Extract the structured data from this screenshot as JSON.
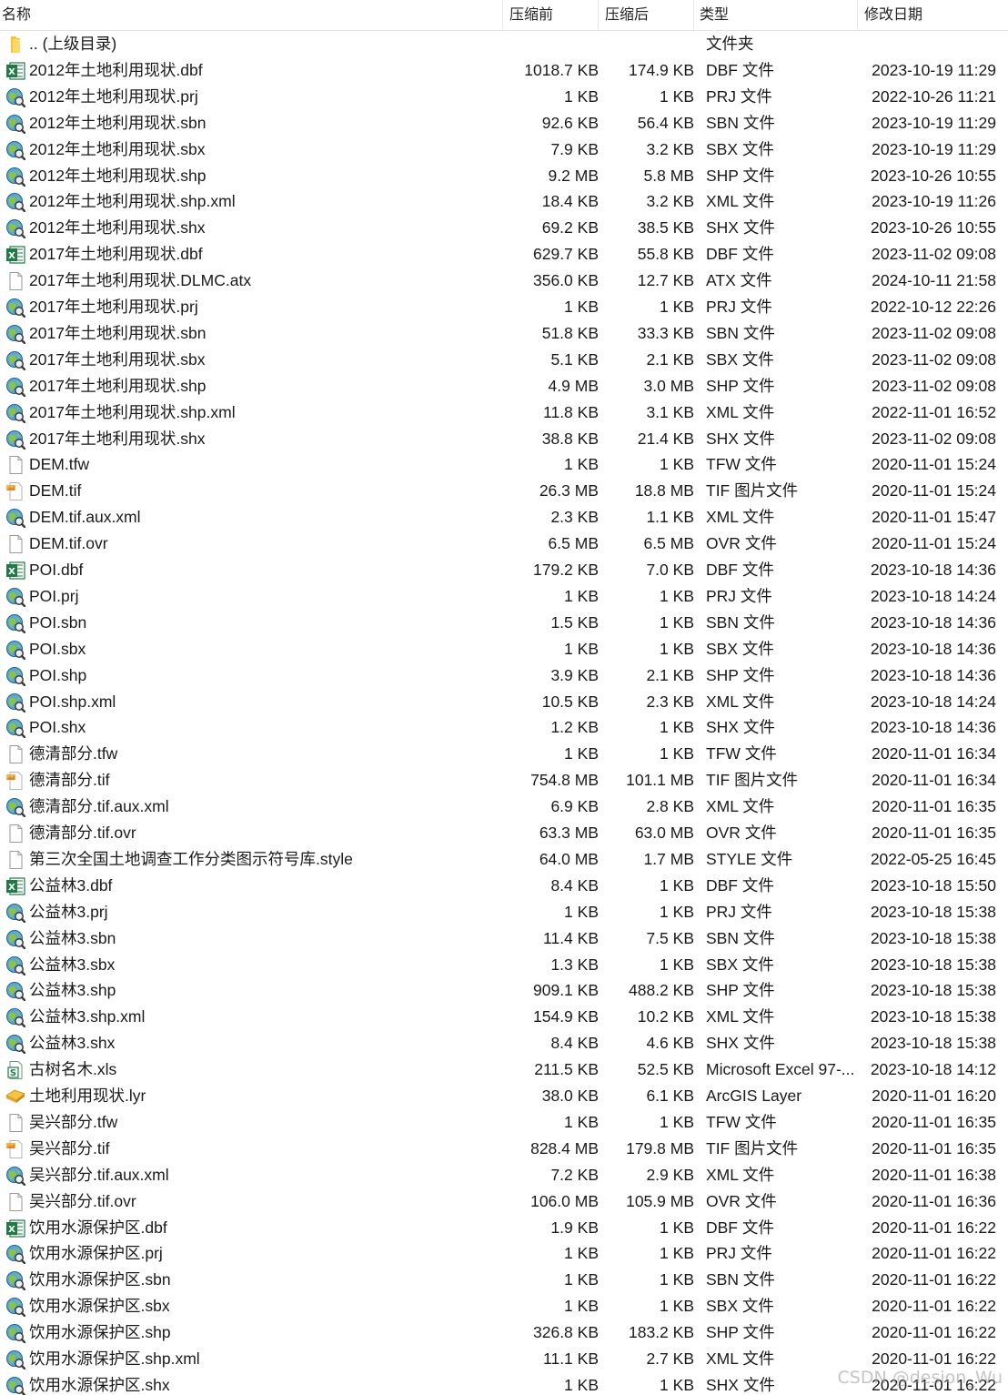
{
  "columns": {
    "name": "名称",
    "size": "压缩前",
    "compressed": "压缩后",
    "type": "类型",
    "modified": "修改日期"
  },
  "files": [
    {
      "icon": "folder-icon",
      "name": ".. (上级目录)",
      "size": "",
      "compressed": "",
      "type": "文件夹",
      "modified": ""
    },
    {
      "icon": "excel-icon",
      "name": "2012年土地利用现状.dbf",
      "size": "1018.7 KB",
      "compressed": "174.9 KB",
      "type": "DBF 文件",
      "modified": "2023-10-19 11:29"
    },
    {
      "icon": "globe-icon",
      "name": "2012年土地利用现状.prj",
      "size": "1 KB",
      "compressed": "1 KB",
      "type": "PRJ 文件",
      "modified": "2022-10-26 11:21"
    },
    {
      "icon": "globe-icon",
      "name": "2012年土地利用现状.sbn",
      "size": "92.6 KB",
      "compressed": "56.4 KB",
      "type": "SBN 文件",
      "modified": "2023-10-19 11:29"
    },
    {
      "icon": "globe-icon",
      "name": "2012年土地利用现状.sbx",
      "size": "7.9 KB",
      "compressed": "3.2 KB",
      "type": "SBX 文件",
      "modified": "2023-10-19 11:29"
    },
    {
      "icon": "globe-icon",
      "name": "2012年土地利用现状.shp",
      "size": "9.2 MB",
      "compressed": "5.8 MB",
      "type": "SHP 文件",
      "modified": "2023-10-26 10:55"
    },
    {
      "icon": "globe-icon",
      "name": "2012年土地利用现状.shp.xml",
      "size": "18.4 KB",
      "compressed": "3.2 KB",
      "type": "XML 文件",
      "modified": "2023-10-19 11:26"
    },
    {
      "icon": "globe-icon",
      "name": "2012年土地利用现状.shx",
      "size": "69.2 KB",
      "compressed": "38.5 KB",
      "type": "SHX 文件",
      "modified": "2023-10-26 10:55"
    },
    {
      "icon": "excel-icon",
      "name": "2017年土地利用现状.dbf",
      "size": "629.7 KB",
      "compressed": "55.8 KB",
      "type": "DBF 文件",
      "modified": "2023-11-02 09:08"
    },
    {
      "icon": "blank-file-icon",
      "name": "2017年土地利用现状.DLMC.atx",
      "size": "356.0 KB",
      "compressed": "12.7 KB",
      "type": "ATX 文件",
      "modified": "2024-10-11 21:58"
    },
    {
      "icon": "globe-icon",
      "name": "2017年土地利用现状.prj",
      "size": "1 KB",
      "compressed": "1 KB",
      "type": "PRJ 文件",
      "modified": "2022-10-12 22:26"
    },
    {
      "icon": "globe-icon",
      "name": "2017年土地利用现状.sbn",
      "size": "51.8 KB",
      "compressed": "33.3 KB",
      "type": "SBN 文件",
      "modified": "2023-11-02 09:08"
    },
    {
      "icon": "globe-icon",
      "name": "2017年土地利用现状.sbx",
      "size": "5.1 KB",
      "compressed": "2.1 KB",
      "type": "SBX 文件",
      "modified": "2023-11-02 09:08"
    },
    {
      "icon": "globe-icon",
      "name": "2017年土地利用现状.shp",
      "size": "4.9 MB",
      "compressed": "3.0 MB",
      "type": "SHP 文件",
      "modified": "2023-11-02 09:08"
    },
    {
      "icon": "globe-icon",
      "name": "2017年土地利用现状.shp.xml",
      "size": "11.8 KB",
      "compressed": "3.1 KB",
      "type": "XML 文件",
      "modified": "2022-11-01 16:52"
    },
    {
      "icon": "globe-icon",
      "name": "2017年土地利用现状.shx",
      "size": "38.8 KB",
      "compressed": "21.4 KB",
      "type": "SHX 文件",
      "modified": "2023-11-02 09:08"
    },
    {
      "icon": "blank-file-icon",
      "name": "DEM.tfw",
      "size": "1 KB",
      "compressed": "1 KB",
      "type": "TFW 文件",
      "modified": "2020-11-01 15:24"
    },
    {
      "icon": "image-file-icon",
      "name": "DEM.tif",
      "size": "26.3 MB",
      "compressed": "18.8 MB",
      "type": "TIF 图片文件",
      "modified": "2020-11-01 15:24"
    },
    {
      "icon": "globe-icon",
      "name": "DEM.tif.aux.xml",
      "size": "2.3 KB",
      "compressed": "1.1 KB",
      "type": "XML 文件",
      "modified": "2020-11-01 15:47"
    },
    {
      "icon": "blank-file-icon",
      "name": "DEM.tif.ovr",
      "size": "6.5 MB",
      "compressed": "6.5 MB",
      "type": "OVR 文件",
      "modified": "2020-11-01 15:24"
    },
    {
      "icon": "excel-icon",
      "name": "POI.dbf",
      "size": "179.2 KB",
      "compressed": "7.0 KB",
      "type": "DBF 文件",
      "modified": "2023-10-18 14:36"
    },
    {
      "icon": "globe-icon",
      "name": "POI.prj",
      "size": "1 KB",
      "compressed": "1 KB",
      "type": "PRJ 文件",
      "modified": "2023-10-18 14:24"
    },
    {
      "icon": "globe-icon",
      "name": "POI.sbn",
      "size": "1.5 KB",
      "compressed": "1 KB",
      "type": "SBN 文件",
      "modified": "2023-10-18 14:36"
    },
    {
      "icon": "globe-icon",
      "name": "POI.sbx",
      "size": "1 KB",
      "compressed": "1 KB",
      "type": "SBX 文件",
      "modified": "2023-10-18 14:36"
    },
    {
      "icon": "globe-icon",
      "name": "POI.shp",
      "size": "3.9 KB",
      "compressed": "2.1 KB",
      "type": "SHP 文件",
      "modified": "2023-10-18 14:36"
    },
    {
      "icon": "globe-icon",
      "name": "POI.shp.xml",
      "size": "10.5 KB",
      "compressed": "2.3 KB",
      "type": "XML 文件",
      "modified": "2023-10-18 14:24"
    },
    {
      "icon": "globe-icon",
      "name": "POI.shx",
      "size": "1.2 KB",
      "compressed": "1 KB",
      "type": "SHX 文件",
      "modified": "2023-10-18 14:36"
    },
    {
      "icon": "blank-file-icon",
      "name": "德清部分.tfw",
      "size": "1 KB",
      "compressed": "1 KB",
      "type": "TFW 文件",
      "modified": "2020-11-01 16:34"
    },
    {
      "icon": "image-file-icon",
      "name": "德清部分.tif",
      "size": "754.8 MB",
      "compressed": "101.1 MB",
      "type": "TIF 图片文件",
      "modified": "2020-11-01 16:34"
    },
    {
      "icon": "globe-icon",
      "name": "德清部分.tif.aux.xml",
      "size": "6.9 KB",
      "compressed": "2.8 KB",
      "type": "XML 文件",
      "modified": "2020-11-01 16:35"
    },
    {
      "icon": "blank-file-icon",
      "name": "德清部分.tif.ovr",
      "size": "63.3 MB",
      "compressed": "63.0 MB",
      "type": "OVR 文件",
      "modified": "2020-11-01 16:35"
    },
    {
      "icon": "blank-file-icon",
      "name": "第三次全国土地调查工作分类图示符号库.style",
      "size": "64.0 MB",
      "compressed": "1.7 MB",
      "type": "STYLE 文件",
      "modified": "2022-05-25 16:45"
    },
    {
      "icon": "excel-icon",
      "name": "公益林3.dbf",
      "size": "8.4 KB",
      "compressed": "1 KB",
      "type": "DBF 文件",
      "modified": "2023-10-18 15:50"
    },
    {
      "icon": "globe-icon",
      "name": "公益林3.prj",
      "size": "1 KB",
      "compressed": "1 KB",
      "type": "PRJ 文件",
      "modified": "2023-10-18 15:38"
    },
    {
      "icon": "globe-icon",
      "name": "公益林3.sbn",
      "size": "11.4 KB",
      "compressed": "7.5 KB",
      "type": "SBN 文件",
      "modified": "2023-10-18 15:38"
    },
    {
      "icon": "globe-icon",
      "name": "公益林3.sbx",
      "size": "1.3 KB",
      "compressed": "1 KB",
      "type": "SBX 文件",
      "modified": "2023-10-18 15:38"
    },
    {
      "icon": "globe-icon",
      "name": "公益林3.shp",
      "size": "909.1 KB",
      "compressed": "488.2 KB",
      "type": "SHP 文件",
      "modified": "2023-10-18 15:38"
    },
    {
      "icon": "globe-icon",
      "name": "公益林3.shp.xml",
      "size": "154.9 KB",
      "compressed": "10.2 KB",
      "type": "XML 文件",
      "modified": "2023-10-18 15:38"
    },
    {
      "icon": "globe-icon",
      "name": "公益林3.shx",
      "size": "8.4 KB",
      "compressed": "4.6 KB",
      "type": "SHX 文件",
      "modified": "2023-10-18 15:38"
    },
    {
      "icon": "spreadsheet-icon",
      "name": "古树名木.xls",
      "size": "211.5 KB",
      "compressed": "52.5 KB",
      "type": "Microsoft Excel 97-...",
      "modified": "2023-10-18 14:12"
    },
    {
      "icon": "layer-icon",
      "name": "土地利用现状.lyr",
      "size": "38.0 KB",
      "compressed": "6.1 KB",
      "type": "ArcGIS Layer",
      "modified": "2020-11-01 16:20"
    },
    {
      "icon": "blank-file-icon",
      "name": "吴兴部分.tfw",
      "size": "1 KB",
      "compressed": "1 KB",
      "type": "TFW 文件",
      "modified": "2020-11-01 16:35"
    },
    {
      "icon": "image-file-icon",
      "name": "吴兴部分.tif",
      "size": "828.4 MB",
      "compressed": "179.8 MB",
      "type": "TIF 图片文件",
      "modified": "2020-11-01 16:35"
    },
    {
      "icon": "globe-icon",
      "name": "吴兴部分.tif.aux.xml",
      "size": "7.2 KB",
      "compressed": "2.9 KB",
      "type": "XML 文件",
      "modified": "2020-11-01 16:38"
    },
    {
      "icon": "blank-file-icon",
      "name": "吴兴部分.tif.ovr",
      "size": "106.0 MB",
      "compressed": "105.9 MB",
      "type": "OVR 文件",
      "modified": "2020-11-01 16:36"
    },
    {
      "icon": "excel-icon",
      "name": "饮用水源保护区.dbf",
      "size": "1.9 KB",
      "compressed": "1 KB",
      "type": "DBF 文件",
      "modified": "2020-11-01 16:22"
    },
    {
      "icon": "globe-icon",
      "name": "饮用水源保护区.prj",
      "size": "1 KB",
      "compressed": "1 KB",
      "type": "PRJ 文件",
      "modified": "2020-11-01 16:22"
    },
    {
      "icon": "globe-icon",
      "name": "饮用水源保护区.sbn",
      "size": "1 KB",
      "compressed": "1 KB",
      "type": "SBN 文件",
      "modified": "2020-11-01 16:22"
    },
    {
      "icon": "globe-icon",
      "name": "饮用水源保护区.sbx",
      "size": "1 KB",
      "compressed": "1 KB",
      "type": "SBX 文件",
      "modified": "2020-11-01 16:22"
    },
    {
      "icon": "globe-icon",
      "name": "饮用水源保护区.shp",
      "size": "326.8 KB",
      "compressed": "183.2 KB",
      "type": "SHP 文件",
      "modified": "2020-11-01 16:22"
    },
    {
      "icon": "globe-icon",
      "name": "饮用水源保护区.shp.xml",
      "size": "11.1 KB",
      "compressed": "2.7 KB",
      "type": "XML 文件",
      "modified": "2020-11-01 16:22"
    },
    {
      "icon": "globe-icon",
      "name": "饮用水源保护区.shx",
      "size": "1 KB",
      "compressed": "1 KB",
      "type": "SHX 文件",
      "modified": "2020-11-01 16:22"
    }
  ],
  "watermark": "CSDN @desion_Wu"
}
